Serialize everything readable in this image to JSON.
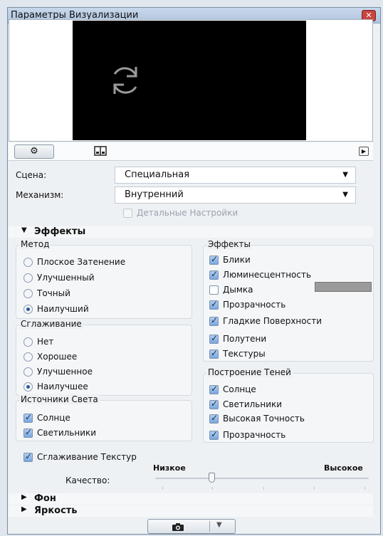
{
  "window": {
    "title": "Параметры Визуализации",
    "close_glyph": "✕"
  },
  "toolbar": {
    "settings_icon": "gear-icon",
    "layout_icon": "split-view-icon",
    "play_icon": "play-icon"
  },
  "scene": {
    "label": "Сцена:",
    "value": "Специальная"
  },
  "engine": {
    "label": "Механизм:",
    "value": "Внутренний"
  },
  "detailed": {
    "label": "Детальные Настройки",
    "checked": false,
    "enabled": false
  },
  "effects_section": {
    "title": "Эффекты",
    "expanded": true
  },
  "method": {
    "title": "Метод",
    "options": [
      "Плоское Затенение",
      "Улучшенный",
      "Точный",
      "Наилучший"
    ],
    "selected": "Наилучший"
  },
  "antialias": {
    "title": "Сглаживание",
    "options": [
      "Нет",
      "Хорошее",
      "Улучшенное",
      "Наилучшее"
    ],
    "selected": "Наилучшее"
  },
  "light_sources": {
    "title": "Источники Света",
    "items": [
      {
        "label": "Солнце",
        "checked": true
      },
      {
        "label": "Светильники",
        "checked": true
      }
    ]
  },
  "effects": {
    "title": "Эффекты",
    "items": [
      {
        "label": "Блики",
        "checked": true
      },
      {
        "label": "Люминесцентность",
        "checked": true
      },
      {
        "label": "Дымка",
        "checked": false
      },
      {
        "label": "Прозрачность",
        "checked": true
      },
      {
        "label": "Гладкие Поверхности",
        "checked": true
      },
      {
        "label": "Полутени",
        "checked": true
      },
      {
        "label": "Текстуры",
        "checked": true
      }
    ],
    "haze_color": "#9a9a9a"
  },
  "shadows": {
    "title": "Построение Теней",
    "items": [
      {
        "label": "Солнце",
        "checked": true
      },
      {
        "label": "Светильники",
        "checked": true
      },
      {
        "label": "Высокая Точность",
        "checked": true
      },
      {
        "label": "Прозрачность",
        "checked": true
      }
    ]
  },
  "texture_smoothing": {
    "label": "Сглаживание Текстур",
    "checked": true
  },
  "quality": {
    "label": "Качество:",
    "low": "Низкое",
    "high": "Высокое",
    "value": 0.25
  },
  "background_section": {
    "title": "Фон",
    "expanded": false
  },
  "brightness_section": {
    "title": "Яркость",
    "expanded": false
  },
  "render_button": {
    "icon": "camera-icon"
  }
}
